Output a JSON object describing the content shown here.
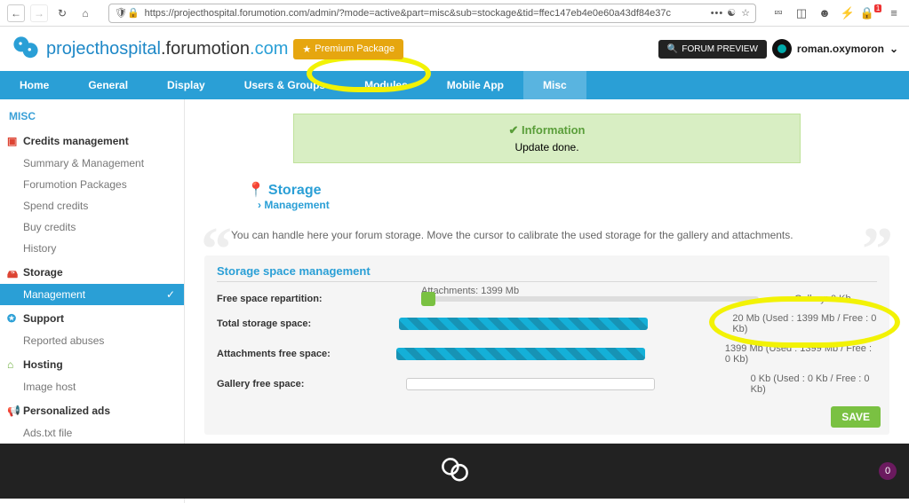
{
  "browser": {
    "url": "https://projecthospital.forumotion.com/admin/?mode=active&part=misc&sub=stockage&tid=ffec147eb4e0e60a43df84e37c",
    "notif_badge": "1"
  },
  "brand": {
    "part1": "projecthospital",
    "part2": ".forumotion",
    "part3": ".com"
  },
  "premium_label": "Premium Package",
  "forum_preview": "FORUM PREVIEW",
  "user": {
    "name": "roman.oxymoron"
  },
  "nav": [
    "Home",
    "General",
    "Display",
    "Users & Groups",
    "Modules",
    "Mobile App",
    "Misc"
  ],
  "sidebar": {
    "title": "MISC",
    "sections": [
      {
        "head": "Credits management",
        "items": [
          "Summary & Management",
          "Forumotion Packages",
          "Spend credits",
          "Buy credits",
          "History"
        ]
      },
      {
        "head": "Storage",
        "items": [
          "Management"
        ]
      },
      {
        "head": "Support",
        "items": [
          "Reported abuses"
        ]
      },
      {
        "head": "Hosting",
        "items": [
          "Image host"
        ]
      },
      {
        "head": "Personalized ads",
        "items": [
          "Ads.txt file"
        ]
      }
    ]
  },
  "info": {
    "title": "Information",
    "body": "Update done."
  },
  "page": {
    "title": "Storage",
    "crumb": "Management"
  },
  "desc": "You can handle here your forum storage. Move the cursor to calibrate the used storage for the gallery and attachments.",
  "panel": {
    "title": "Storage space management",
    "rows": {
      "free": {
        "label": "Free space repartition:",
        "attach": "Attachments: 1399 Mb",
        "gallery": "Gallery: 0 Kb"
      },
      "total": {
        "label": "Total storage space:",
        "value": "20 Mb (Used : 1399 Mb / Free : 0 Kb)"
      },
      "attach": {
        "label": "Attachments free space:",
        "value": "1399 Mb (Used : 1399 Mb / Free : 0 Kb)"
      },
      "gal": {
        "label": "Gallery free space:",
        "value": "0 Kb (Used : 0 Kb / Free : 0 Kb)"
      }
    },
    "save": "SAVE"
  },
  "bottom": {
    "count": "0"
  }
}
